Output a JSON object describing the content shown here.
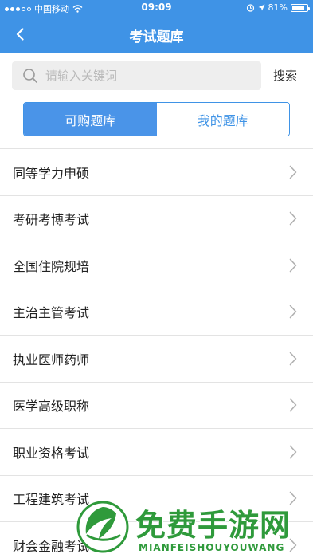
{
  "status_bar": {
    "carrier": "中国移动",
    "time": "09:09",
    "battery": "81%",
    "battery_level": 0.81
  },
  "nav": {
    "title": "考试题库"
  },
  "search": {
    "placeholder": "请输入关键词",
    "value": "",
    "button_label": "搜索"
  },
  "tabs": [
    {
      "label": "可购题库",
      "active": true
    },
    {
      "label": "我的题库",
      "active": false
    }
  ],
  "list": {
    "items": [
      {
        "label": "同等学力申硕"
      },
      {
        "label": "考研考博考试"
      },
      {
        "label": "全国住院规培"
      },
      {
        "label": "主治主管考试"
      },
      {
        "label": "执业医师药师"
      },
      {
        "label": "医学高级职称"
      },
      {
        "label": "职业资格考试"
      },
      {
        "label": "工程建筑考试"
      },
      {
        "label": "财会金融考试"
      }
    ]
  },
  "watermark": {
    "text": "免费手游网",
    "subtext": "MIANFEISHOUYOUWANG"
  },
  "colors": {
    "brand_blue": "#3f93e6",
    "watermark_green": "#2f9a3b"
  }
}
